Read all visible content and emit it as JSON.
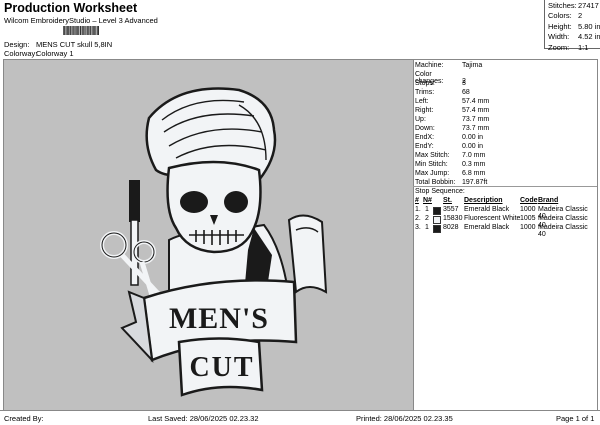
{
  "header": {
    "title": "Production Worksheet",
    "subtitle": "Wilcom EmbroideryStudio – Level 3 Advanced",
    "design_label": "Design:",
    "design_value": "MENS CUT skull 5,8IN",
    "colorway_label": "Colorway:",
    "colorway_value": "Colorway 1"
  },
  "top_stats": [
    {
      "label": "Stitches:",
      "value": "27417"
    },
    {
      "label": "Colors:",
      "value": "2"
    },
    {
      "label": "Height:",
      "value": "5.80 in"
    },
    {
      "label": "Width:",
      "value": "4.52 in"
    },
    {
      "label": "Zoom:",
      "value": "1:1"
    }
  ],
  "design": {
    "banner_line1": "MEN'S",
    "banner_line2": "CUT",
    "colors": {
      "background": "#c0c0c0",
      "black": "#1a1a1a",
      "white": "#f2f4f6"
    }
  },
  "info": [
    {
      "label": "Machine:",
      "value": "Tajima"
    },
    {
      "label": "Color changes:",
      "value": "2"
    },
    {
      "label": "Stops:",
      "value": "3"
    },
    {
      "label": "Trims:",
      "value": "68"
    },
    {
      "label": "Left:",
      "value": "57.4 mm"
    },
    {
      "label": "Right:",
      "value": "57.4 mm"
    },
    {
      "label": "Up:",
      "value": "73.7 mm"
    },
    {
      "label": "Down:",
      "value": "73.7 mm"
    },
    {
      "label": "EndX:",
      "value": "0.00 in"
    },
    {
      "label": "EndY:",
      "value": "0.00 in"
    },
    {
      "label": "Max Stitch:",
      "value": "7.0 mm"
    },
    {
      "label": "Min Stitch:",
      "value": "0.3 mm"
    },
    {
      "label": "Max Jump:",
      "value": "6.8 mm"
    },
    {
      "label": "Total Bobbin:",
      "value": "197.87ft"
    }
  ],
  "stop_sequence": {
    "title": "Stop Sequence:",
    "headers": [
      "#",
      "N#",
      "St.",
      "Description",
      "Code",
      "Brand"
    ],
    "rows": [
      {
        "num": "1.",
        "n": "1",
        "color": "#1a1a1a",
        "st": "3557",
        "desc": "Emerald Black",
        "code": "1000",
        "brand": "Madeira Classic 40"
      },
      {
        "num": "2.",
        "n": "2",
        "color": "#f2f4f6",
        "st": "15830",
        "desc": "Fluorescent White",
        "code": "1005",
        "brand": "Madeira Classic 40"
      },
      {
        "num": "3.",
        "n": "1",
        "color": "#1a1a1a",
        "st": "8028",
        "desc": "Emerald Black",
        "code": "1000",
        "brand": "Madeira Classic 40"
      }
    ]
  },
  "footer": {
    "created_by": "Created By:",
    "last_saved": "Last Saved: 28/06/2025 02.23.32",
    "printed": "Printed: 28/06/2025 02.23.35",
    "page": "Page 1 of 1"
  }
}
